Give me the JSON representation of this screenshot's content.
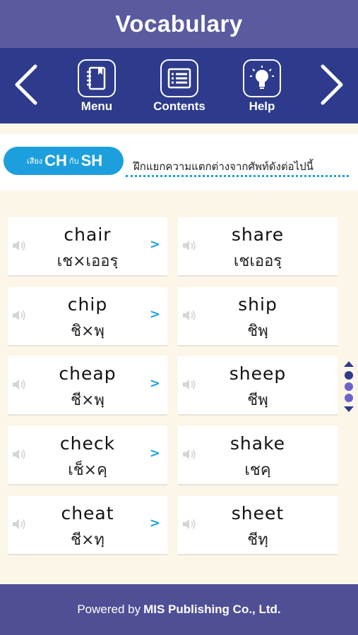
{
  "header": {
    "title": "Vocabulary"
  },
  "toolbar": {
    "menu_label": "Menu",
    "contents_label": "Contents",
    "help_label": "Help"
  },
  "banner": {
    "pill_prefix": "เสียง",
    "pill_first": "CH",
    "pill_mid": "กับ",
    "pill_second": "SH",
    "instruction": "ฝึกแยกความแตกต่างจากศัพท์ดังต่อไปนี้"
  },
  "cards": [
    {
      "word": "chair",
      "thai": "เช×เออรฺ"
    },
    {
      "word": "share",
      "thai": "เชเออรฺ"
    },
    {
      "word": "chip",
      "thai": "ชิ×พฺ"
    },
    {
      "word": "ship",
      "thai": "ชิพฺ"
    },
    {
      "word": "cheap",
      "thai": "ชี×พฺ"
    },
    {
      "word": "sheep",
      "thai": "ชีพฺ"
    },
    {
      "word": "check",
      "thai": "เช็×คฺ"
    },
    {
      "word": "shake",
      "thai": "เชคฺ"
    },
    {
      "word": "cheat",
      "thai": "ชี×ทฺ"
    },
    {
      "word": "sheet",
      "thai": "ชีทฺ"
    }
  ],
  "card_arrow": ">",
  "footer": {
    "prefix": "Powered by",
    "company": "MIS Publishing Co., Ltd."
  },
  "colors": {
    "title_bar": "#5a5a9f",
    "toolbar": "#2e3b8c",
    "accent_blue": "#1d9fde",
    "footer": "#4f4f96",
    "background": "#fbf6e8"
  },
  "icons": {
    "prev": "chevron-left-icon",
    "menu": "notebook-icon",
    "contents": "list-icon",
    "help": "lightbulb-icon",
    "next": "chevron-right-icon",
    "speaker": "speaker-icon"
  }
}
